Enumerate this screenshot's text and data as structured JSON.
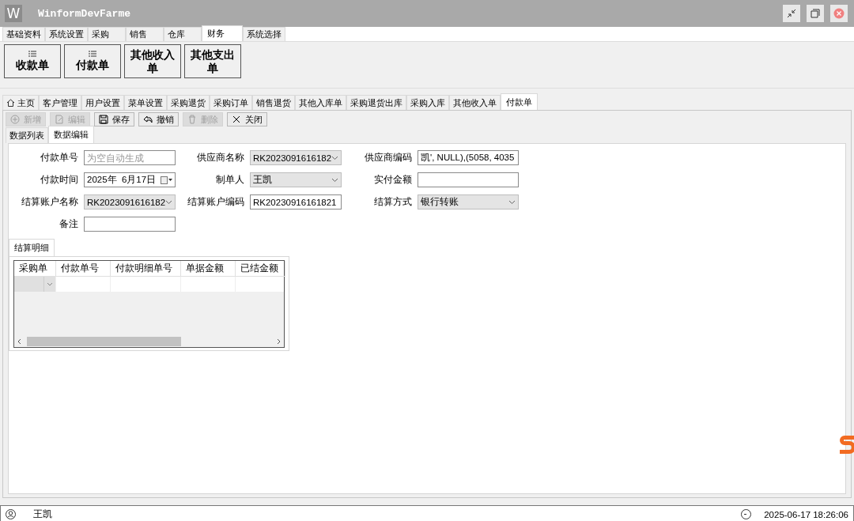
{
  "window": {
    "logo": "W",
    "title": "WinformDevFarme"
  },
  "menu_tabs": [
    {
      "label": "基础资料",
      "selected": false
    },
    {
      "label": "系统设置",
      "selected": false
    },
    {
      "label": "采购",
      "selected": false
    },
    {
      "label": "销售",
      "selected": false
    },
    {
      "label": "仓库",
      "selected": false
    },
    {
      "label": "财务",
      "selected": true
    },
    {
      "label": "系统选择",
      "selected": false
    }
  ],
  "ribbon_buttons": [
    {
      "label": "收款单",
      "kind": "icon"
    },
    {
      "label": "付款单",
      "kind": "icon"
    },
    {
      "label": "其他收入单",
      "kind": "plain"
    },
    {
      "label": "其他支出单",
      "kind": "plain"
    }
  ],
  "doc_tabs": [
    {
      "label": "主页",
      "kind": "home",
      "selected": false
    },
    {
      "label": "客户管理",
      "kind": "plain",
      "selected": false
    },
    {
      "label": "用户设置",
      "kind": "plain",
      "selected": false
    },
    {
      "label": "菜单设置",
      "kind": "plain",
      "selected": false
    },
    {
      "label": "采购退货",
      "kind": "plain",
      "selected": false
    },
    {
      "label": "采购订单",
      "kind": "plain",
      "selected": false
    },
    {
      "label": "销售退货",
      "kind": "plain",
      "selected": false
    },
    {
      "label": "其他入库单",
      "kind": "plain",
      "selected": false
    },
    {
      "label": "采购退货出库",
      "kind": "plain",
      "selected": false
    },
    {
      "label": "采购入库",
      "kind": "plain",
      "selected": false
    },
    {
      "label": "其他收入单",
      "kind": "plain",
      "selected": false
    },
    {
      "label": "付款单",
      "kind": "plain",
      "selected": true
    }
  ],
  "toolbar": [
    {
      "label": "新增",
      "disabled": true
    },
    {
      "label": "编辑",
      "disabled": true
    },
    {
      "label": "保存",
      "disabled": false
    },
    {
      "label": "撤销",
      "disabled": false
    },
    {
      "label": "删除",
      "disabled": true
    },
    {
      "label": "关闭",
      "disabled": false
    }
  ],
  "sub_tabs": [
    {
      "label": "数据列表",
      "selected": false
    },
    {
      "label": "数据编辑",
      "selected": true
    }
  ],
  "form_fields": [
    {
      "label": "付款单号",
      "kind": "text",
      "placeholder": "为空自动生成"
    },
    {
      "label": "供应商名称",
      "kind": "combo",
      "value": "RK2023091616182"
    },
    {
      "label": "供应商编码",
      "kind": "text",
      "value": "凯', NULL),(5058, 4035"
    },
    {
      "label": "付款时间",
      "kind": "date",
      "value": "2025年  6月17日"
    },
    {
      "label": "制单人",
      "kind": "combo",
      "value": "王凯"
    },
    {
      "label": "实付金额",
      "kind": "text"
    },
    {
      "label": "结算账户名称",
      "kind": "combo",
      "value": "RK2023091616182"
    },
    {
      "label": "结算账户编码",
      "kind": "text",
      "value": "RK20230916161821"
    },
    {
      "label": "结算方式",
      "kind": "combo",
      "value": "银行转账"
    },
    {
      "label": "备注",
      "kind": "text"
    }
  ],
  "detail_tabs": [
    {
      "label": "结算明细",
      "selected": true
    }
  ],
  "grid": {
    "columns": [
      "采购单",
      "付款单号",
      "付款明细单号",
      "单据金额",
      "已结金额"
    ]
  },
  "status_bar": {
    "user": "王凯",
    "datetime": "2025-06-17 18:26:06"
  }
}
